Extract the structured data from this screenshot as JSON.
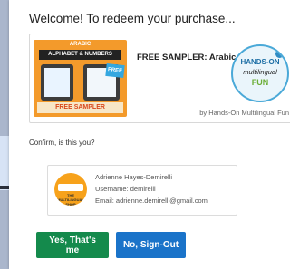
{
  "modal": {
    "title": "Welcome! To redeem your purchase..."
  },
  "product": {
    "title": "FREE SAMPLER: Arabic L...",
    "by_line": "by Hands-On Multilingual Fun",
    "thumbnail": {
      "line1": "ARABIC",
      "line2": "ALPHABET & NUMBERS",
      "tag": "FREE",
      "banner": "FREE SAMPLER"
    },
    "logo": {
      "line1": "HANDS-ON",
      "line2": "multilingual",
      "line3": "FUN"
    }
  },
  "confirm_prompt": "Confirm, is this you?",
  "user": {
    "name": "Adrienne Hayes-Demirelli",
    "username_line": "Username: demirelli",
    "email_line": "Email: adrienne.demirelli@gmail.com",
    "avatar_text": "THE MULTILINGUAL SHOP"
  },
  "actions": {
    "confirm_label": "Yes, That's me",
    "signout_label": "No, Sign-Out"
  },
  "colors": {
    "confirm_button": "#148a4c",
    "signout_button": "#1a73c9",
    "thumbnail_bg": "#f39a2b"
  }
}
